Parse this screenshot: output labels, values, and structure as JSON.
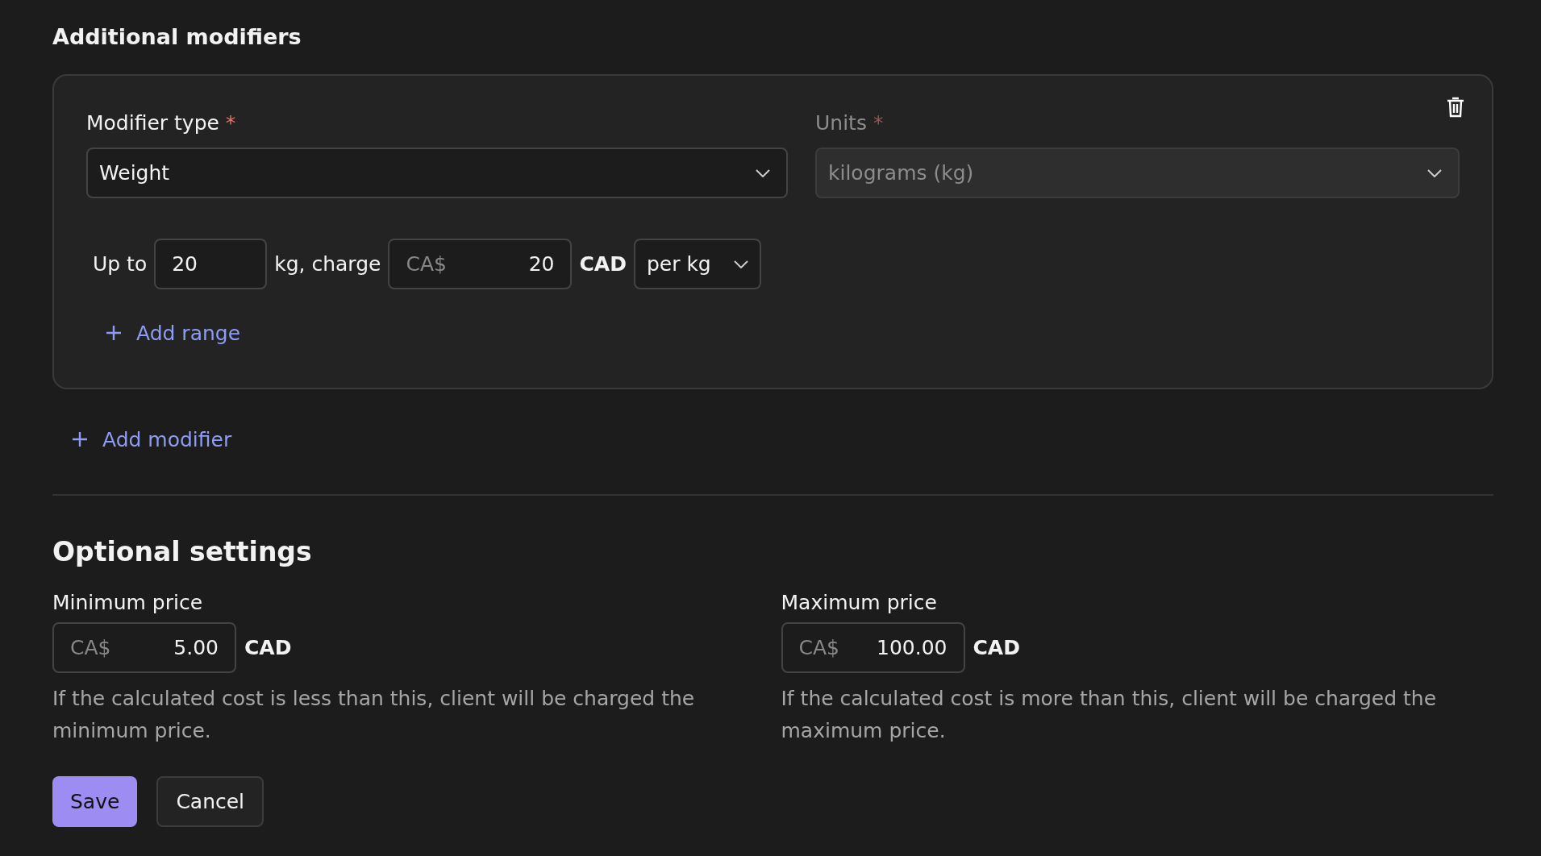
{
  "section_title": "Additional modifiers",
  "modifiers": [
    {
      "fields": [
        {
          "label": "Modifier type",
          "required_mark": "*",
          "value": "Weight",
          "disabled": false
        },
        {
          "label": "Units",
          "required_mark": "*",
          "value": "kilograms (kg)",
          "disabled": true
        }
      ],
      "ranges": [
        {
          "prefix": "Up to",
          "limit": "20",
          "unit_label": "kg, charge",
          "currency_prefix": "CA$",
          "amount": "20",
          "currency": "CAD",
          "rate": "per kg"
        }
      ],
      "add_range": "Add range"
    }
  ],
  "add_modifier": "Add modifier",
  "optional": {
    "title": "Optional settings",
    "prices": [
      {
        "label": "Minimum price",
        "prefix": "CA$",
        "value": "5.00",
        "currency": "CAD",
        "help": "If the calculated cost is less than this, client will be charged the minimum price."
      },
      {
        "label": "Maximum price",
        "prefix": "CA$",
        "value": "100.00",
        "currency": "CAD",
        "help": "If the calculated cost is more than this, client will be charged the maximum price."
      }
    ]
  },
  "buttons": [
    {
      "label": "Save",
      "kind": "primary"
    },
    {
      "label": "Cancel",
      "kind": "secondary"
    }
  ]
}
